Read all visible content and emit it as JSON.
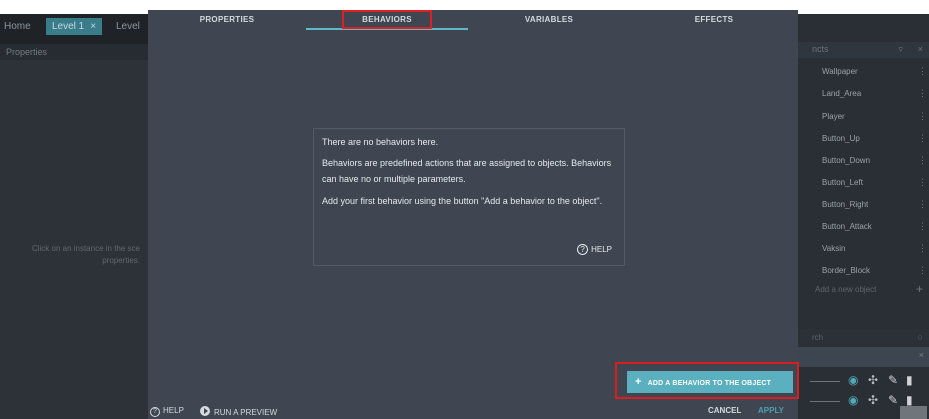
{
  "background": {
    "tabs": {
      "home": "Home",
      "level1": "Level 1",
      "close": "×",
      "level_cut": "Level"
    },
    "properties_header": "Properties",
    "properties_hint_line1": "Click on an instance in the sce",
    "properties_hint_line2": "properties.",
    "objects_header": "ncts",
    "objects": [
      "Wallpaper",
      "Land_Area",
      "Player",
      "Button_Up",
      "Button_Down",
      "Button_Left",
      "Button_Right",
      "Button_Attack",
      "Vaksin",
      "Border_Block"
    ],
    "add_object": "Add a new object",
    "search_placeholder": "rch"
  },
  "dialog": {
    "tabs": [
      "PROPERTIES",
      "BEHAVIORS",
      "VARIABLES",
      "EFFECTS"
    ],
    "active_tab": "BEHAVIORS",
    "empty_title": "There are no behaviors here.",
    "empty_text_1": "Behaviors are predefined actions that are assigned to objects. Behaviors can have no or multiple parameters.",
    "empty_text_2": "Add your first behavior using the button \"Add a behavior to the object\".",
    "empty_help": "HELP",
    "add_behavior_button": "ADD A BEHAVIOR TO THE OBJECT",
    "footer": {
      "help": "HELP",
      "run_preview": "RUN A PREVIEW",
      "cancel": "CANCEL",
      "apply": "APPLY"
    }
  },
  "colors": {
    "accent": "#5ab0bf",
    "highlight": "#e02020",
    "dialog_bg": "#3f4651"
  }
}
